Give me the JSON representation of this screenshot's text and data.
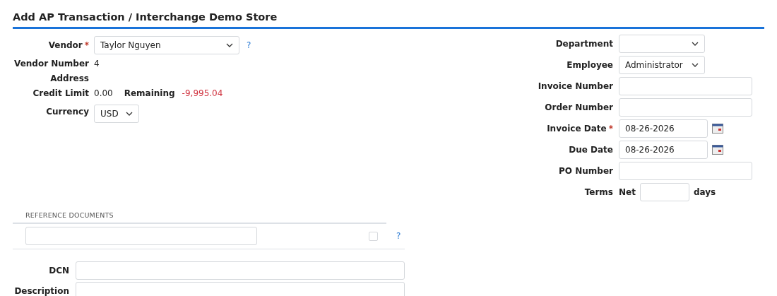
{
  "title": "Add AP Transaction / Interchange Demo Store",
  "left_fields": [
    {
      "kind": "select",
      "label": "Vendor",
      "required_mark": "*",
      "value": "Taylor Nguyen",
      "help": "?"
    },
    {
      "kind": "static",
      "label": "Vendor Number",
      "value": "4"
    },
    {
      "kind": "static",
      "label": "Address"
    },
    {
      "kind": "credit",
      "label": "Credit Limit",
      "value": "0.00",
      "remaining_label": "Remaining",
      "remaining_value": "-9,995.04"
    },
    {
      "kind": "select",
      "label": "Currency",
      "value": "USD"
    }
  ],
  "right_fields": [
    {
      "kind": "select",
      "label": "Department"
    },
    {
      "kind": "select",
      "label": "Employee",
      "value": "Administrator"
    },
    {
      "kind": "text",
      "label": "Invoice Number"
    },
    {
      "kind": "text",
      "label": "Order Number"
    },
    {
      "kind": "date",
      "label": "Invoice Date",
      "required_mark": "*",
      "value": "08-26-2026"
    },
    {
      "kind": "date",
      "label": "Due Date",
      "value": "08-26-2026"
    },
    {
      "kind": "text",
      "label": "PO Number"
    },
    {
      "kind": "terms",
      "label": "Terms",
      "prefix": "Net",
      "suffix": "days"
    }
  ],
  "reference_documents": {
    "heading": "REFERENCE DOCUMENTS",
    "checked": false,
    "help": "?"
  },
  "bottom_fields": [
    {
      "label": "DCN"
    },
    {
      "label": "Description"
    }
  ]
}
